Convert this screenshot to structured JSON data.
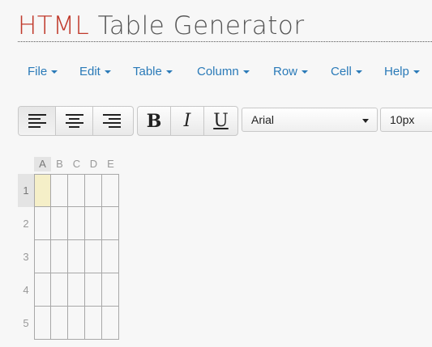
{
  "header": {
    "title_accent": "HTML",
    "title_rest": " Table Generator"
  },
  "menu": [
    {
      "label": "File"
    },
    {
      "label": "Edit"
    },
    {
      "label": "Table"
    },
    {
      "label": "Column"
    },
    {
      "label": "Row"
    },
    {
      "label": "Cell"
    },
    {
      "label": "Help"
    }
  ],
  "toolbar": {
    "bold_label": "B",
    "italic_label": "I",
    "underline_label": "U",
    "font_family_value": "Arial",
    "font_size_value": "10px"
  },
  "grid": {
    "columns": [
      "A",
      "B",
      "C",
      "D",
      "E"
    ],
    "rows": [
      "1",
      "2",
      "3",
      "4",
      "5"
    ],
    "selected_cell": "A1"
  },
  "colors": {
    "accent": "#c0392b",
    "link": "#2a7ab8",
    "selected_cell": "#f5efc8"
  }
}
